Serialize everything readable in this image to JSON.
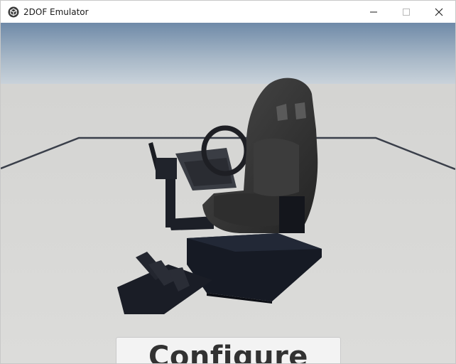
{
  "window": {
    "title": "2DOF Emulator",
    "icon": "unity-cube-icon"
  },
  "controls": {
    "minimize_icon": "minimize-icon",
    "maximize_icon": "maximize-icon",
    "close_icon": "close-icon"
  },
  "scene": {
    "description_icon": "racing-simulator-rig",
    "sky_top": "#6f8aa8",
    "sky_horizon": "#c9d2da",
    "floor": "#d8d8d6"
  },
  "main": {
    "configure_label": "Configure"
  }
}
